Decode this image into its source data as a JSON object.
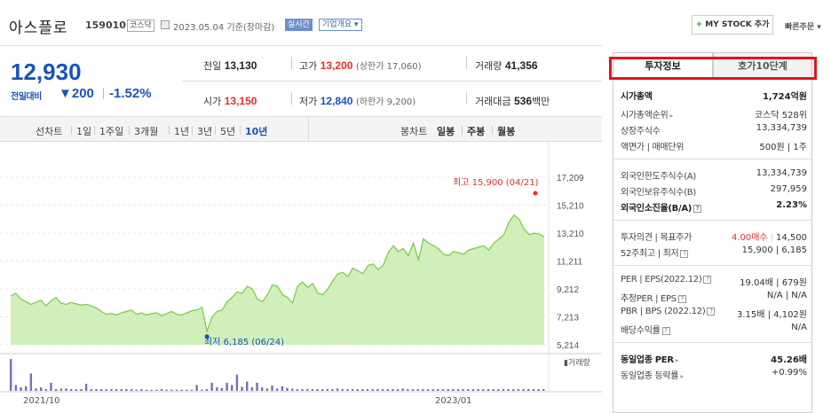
{
  "header": {
    "stock_name": "아스플로",
    "stock_code": "159010",
    "market_badge": "코스닥",
    "asof": "2023.05.04 기준(장마감)",
    "realtime_label": "실시간",
    "overview_label": "기업개요",
    "mystock_label": "MY STOCK 추가",
    "quick_order_label": "빠른주문"
  },
  "price": {
    "current": "12,930",
    "change_label": "전일대비",
    "change_value": "200",
    "change_pct": "-1.52%"
  },
  "quote": {
    "prev_close_label": "전일",
    "prev_close": "13,130",
    "high_label": "고가",
    "high": "13,200",
    "high_note": "(상한가 17,060)",
    "volume_label": "거래량",
    "volume": "41,356",
    "open_label": "시가",
    "open": "13,150",
    "low_label": "저가",
    "low": "12,840",
    "low_note": "(하한가 9,200)",
    "amount_label": "거래대금",
    "amount": "536",
    "amount_unit": "백만"
  },
  "period_bar": {
    "line_label": "선차트",
    "line_periods": [
      "1일",
      "1주일",
      "3개월",
      "1년",
      "3년",
      "5년",
      "10년"
    ],
    "active_period": "10년",
    "candle_label": "봉차트",
    "candle_periods": [
      "일봉",
      "주봉",
      "월봉"
    ]
  },
  "chart_data": {
    "type": "area",
    "y_ticks": [
      "17,209",
      "15,210",
      "13,210",
      "11,211",
      "9,212",
      "7,213",
      "5,214"
    ],
    "ylim": [
      5214,
      17209
    ],
    "x_ticks": [
      "2021/10",
      "2023/01"
    ],
    "max_label": "최고 15,900 (04/21)",
    "min_label": "최저 6,185 (06/24)",
    "volume_legend": "거래량",
    "values": [
      8700,
      8900,
      8500,
      8300,
      8100,
      8250,
      8400,
      8000,
      8350,
      8600,
      8200,
      8100,
      8250,
      8150,
      8050,
      8100,
      8000,
      7850,
      7600,
      7400,
      7450,
      7350,
      7500,
      7600,
      7700,
      7400,
      7500,
      7350,
      7450,
      7500,
      7300,
      7450,
      7600,
      7400,
      7350,
      7500,
      7650,
      7700,
      7900,
      6185,
      7200,
      7600,
      7700,
      8300,
      8600,
      9000,
      8900,
      9400,
      9200,
      8500,
      8300,
      8800,
      9500,
      9400,
      8800,
      8600,
      8200,
      9400,
      9700,
      9300,
      9600,
      8900,
      8800,
      9200,
      9800,
      10300,
      10400,
      10100,
      10700,
      10500,
      10300,
      10900,
      11000,
      10600,
      10900,
      11800,
      12300,
      11900,
      12100,
      11600,
      12500,
      11300,
      12800,
      12500,
      12300,
      12100,
      11700,
      11600,
      11900,
      11800,
      11700,
      12000,
      12100,
      12200,
      12300,
      12000,
      12500,
      12800,
      13100,
      14000,
      14500,
      14200,
      13500,
      13100,
      13200,
      13150,
      12930
    ],
    "volumes": [
      55,
      10,
      6,
      8,
      30,
      4,
      6,
      3,
      14,
      3,
      4,
      4,
      3,
      3,
      3,
      12,
      3,
      3,
      3,
      3,
      3,
      3,
      3,
      3,
      3,
      2,
      3,
      2,
      2,
      2,
      3,
      2,
      2,
      2,
      2,
      2,
      2,
      10,
      2,
      3,
      14,
      6,
      5,
      14,
      10,
      28,
      7,
      16,
      6,
      14,
      6,
      4,
      9,
      4,
      8,
      5,
      4,
      3,
      3,
      3,
      3,
      3,
      3,
      3,
      3,
      4,
      3,
      3,
      3,
      3,
      3,
      3,
      3,
      3,
      3,
      3,
      3,
      3,
      4,
      3,
      3,
      3,
      3,
      3,
      3,
      3,
      3,
      3,
      3,
      3,
      3,
      3,
      3,
      3,
      3,
      3,
      3,
      3,
      3,
      3,
      3,
      3,
      3,
      3,
      3,
      3,
      3
    ]
  },
  "right_panel": {
    "tab_info": "투자정보",
    "tab_hoga": "호가10단계",
    "market_cap_label": "시가총액",
    "market_cap": "1,724억원",
    "market_cap_rank_label": "시가총액순위",
    "market_cap_rank": "코스닥 528위",
    "shares_label": "상장주식수",
    "shares": "13,334,739",
    "par_label": "액면가 | 매매단위",
    "par": "500원 | 1주",
    "foreign_limit_label": "외국인한도주식수(A)",
    "foreign_limit": "13,334,739",
    "foreign_hold_label": "외국인보유주식수(B)",
    "foreign_hold": "297,959",
    "foreign_ratio_label": "외국인소진율(B/A)",
    "foreign_ratio": "2.23%",
    "opinion_label": "투자의견 | 목표주가",
    "opinion": "4.00매수",
    "target_price": "14,500",
    "wk52_label": "52주최고 | 최저",
    "wk52": "15,900 | 6,185",
    "per_label": "PER | EPS(2022.12)",
    "per": "19.04배 | 679원",
    "est_per_label": "추정PER | EPS",
    "est_per": "N/A | N/A",
    "pbr_label": "PBR | BPS (2022.12)",
    "pbr": "3.15배 | 4,102원",
    "div_label": "배당수익률",
    "div": "N/A",
    "ind_per_label": "동일업종 PER",
    "ind_per": "45.26배",
    "ind_change_label": "동일업종 등락률",
    "ind_change": "+0.99%"
  }
}
